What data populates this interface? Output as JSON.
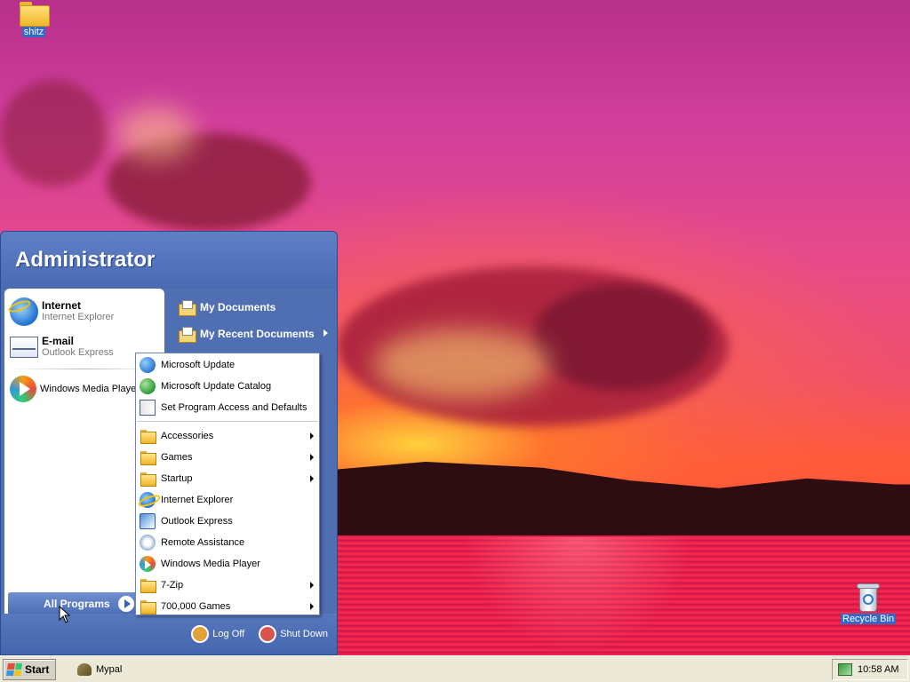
{
  "desktop": {
    "icons": [
      {
        "label": "shitz",
        "icon": "folder-icon"
      },
      {
        "label": "Recycle Bin",
        "icon": "recycle-bin-icon"
      }
    ]
  },
  "start_menu": {
    "user": "Administrator",
    "pinned": [
      {
        "primary": "Internet",
        "secondary": "Internet Explorer",
        "icon": "internet-explorer-icon"
      },
      {
        "primary": "E-mail",
        "secondary": "Outlook Express",
        "icon": "outlook-express-icon"
      }
    ],
    "recent": [
      {
        "label": "Windows Media Player",
        "icon": "windows-media-player-icon"
      }
    ],
    "all_programs_label": "All Programs",
    "right": [
      {
        "label": "My Documents",
        "icon": "my-documents-icon",
        "has_submenu": false
      },
      {
        "label": "My Recent Documents",
        "icon": "my-recent-documents-icon",
        "has_submenu": true
      }
    ],
    "footer": {
      "log_off": "Log Off",
      "shut_down": "Shut Down"
    }
  },
  "programs_menu": {
    "top_items": [
      {
        "label": "Microsoft Update",
        "icon": "microsoft-update-icon"
      },
      {
        "label": "Microsoft Update Catalog",
        "icon": "update-catalog-icon"
      },
      {
        "label": "Set Program Access and Defaults",
        "icon": "program-access-icon"
      }
    ],
    "items": [
      {
        "label": "Accessories",
        "icon": "folder-icon",
        "has_submenu": true
      },
      {
        "label": "Games",
        "icon": "folder-icon",
        "has_submenu": true
      },
      {
        "label": "Startup",
        "icon": "folder-icon",
        "has_submenu": true
      },
      {
        "label": "Internet Explorer",
        "icon": "internet-explorer-icon",
        "has_submenu": false
      },
      {
        "label": "Outlook Express",
        "icon": "outlook-express-icon",
        "has_submenu": false
      },
      {
        "label": "Remote Assistance",
        "icon": "remote-assistance-icon",
        "has_submenu": false
      },
      {
        "label": "Windows Media Player",
        "icon": "windows-media-player-icon",
        "has_submenu": false
      },
      {
        "label": "7-Zip",
        "icon": "folder-icon",
        "has_submenu": true
      },
      {
        "label": "700,000 Games",
        "icon": "folder-icon",
        "has_submenu": true
      }
    ]
  },
  "taskbar": {
    "start_label": "Start",
    "tasks": [
      {
        "label": "Mypal",
        "icon": "mypal-icon"
      }
    ],
    "clock": "10:58 AM"
  }
}
